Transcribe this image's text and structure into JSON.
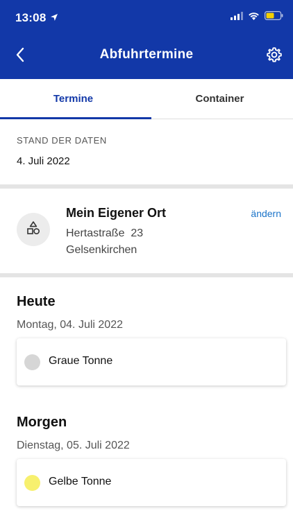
{
  "status": {
    "time": "13:08"
  },
  "header": {
    "title": "Abfuhrtermine"
  },
  "tabs": [
    {
      "label": "Termine"
    },
    {
      "label": "Container"
    }
  ],
  "stand": {
    "label": "STAND DER DATEN",
    "date": "4. Juli 2022"
  },
  "location": {
    "name": "Mein Eigener Ort",
    "street": "Hertastraße  23",
    "city": "Gelsenkirchen",
    "change_label": "ändern"
  },
  "days": [
    {
      "title": "Heute",
      "date": "Montag, 04. Juli 2022",
      "item": "Graue Tonne",
      "color": "#d6d6d6"
    },
    {
      "title": "Morgen",
      "date": "Dienstag, 05. Juli 2022",
      "item": "Gelbe Tonne",
      "color": "#f7f06e"
    }
  ],
  "colors": {
    "brand": "#1238a8",
    "link": "#1a73c8",
    "battery": "#f5d000"
  }
}
